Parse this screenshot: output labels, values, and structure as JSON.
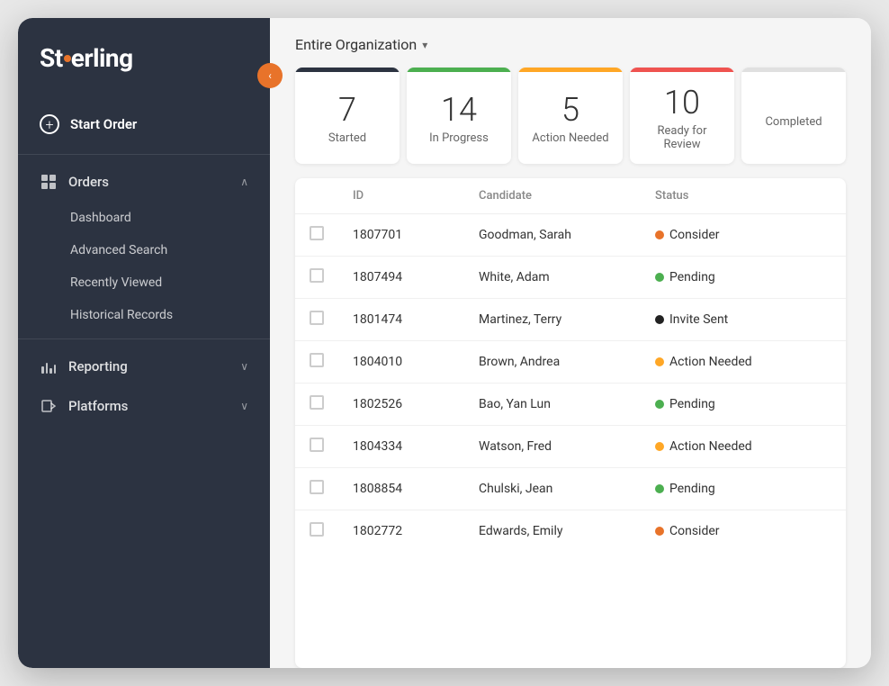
{
  "app": {
    "name": "Sterling",
    "logo_dot": "·"
  },
  "sidebar": {
    "collapse_icon": "‹",
    "start_order": "Start Order",
    "nav_items": [
      {
        "id": "orders",
        "label": "Orders",
        "icon": "grid",
        "has_chevron": true,
        "chevron": "∧",
        "sub_items": [
          "Dashboard",
          "Advanced Search",
          "Recently Viewed",
          "Historical Records"
        ]
      },
      {
        "id": "reporting",
        "label": "Reporting",
        "icon": "bar",
        "has_chevron": true,
        "chevron": "∨"
      },
      {
        "id": "platforms",
        "label": "Platforms",
        "icon": "platform",
        "has_chevron": true,
        "chevron": "∨"
      }
    ]
  },
  "header": {
    "org_selector": "Entire Organization",
    "dropdown_arrow": "▾"
  },
  "stats": [
    {
      "id": "started",
      "number": "7",
      "label": "Started",
      "color": "#2c3341",
      "bar_color": "#2c3341"
    },
    {
      "id": "in-progress",
      "number": "14",
      "label": "In Progress",
      "color": "#4caf50",
      "bar_color": "#4caf50"
    },
    {
      "id": "action-needed",
      "number": "5",
      "label": "Action Needed",
      "color": "#ffa726",
      "bar_color": "#ffa726"
    },
    {
      "id": "ready-for-review",
      "number": "10",
      "label": "Ready for Review",
      "color": "#ef5350",
      "bar_color": "#ef5350"
    },
    {
      "id": "completed",
      "number": "",
      "label": "Completed",
      "color": "#e0e0e0",
      "bar_color": "#e0e0e0"
    }
  ],
  "table": {
    "columns": [
      "",
      "ID",
      "Candidate",
      "Status"
    ],
    "rows": [
      {
        "id": "1807701",
        "candidate": "Goodman, Sarah",
        "status": "Consider",
        "status_color": "#e8732a"
      },
      {
        "id": "1807494",
        "candidate": "White, Adam",
        "status": "Pending",
        "status_color": "#4caf50"
      },
      {
        "id": "1801474",
        "candidate": "Martinez, Terry",
        "status": "Invite Sent",
        "status_color": "#222"
      },
      {
        "id": "1804010",
        "candidate": "Brown, Andrea",
        "status": "Action Needed",
        "status_color": "#ffa726"
      },
      {
        "id": "1802526",
        "candidate": "Bao, Yan Lun",
        "status": "Pending",
        "status_color": "#4caf50"
      },
      {
        "id": "1804334",
        "candidate": "Watson, Fred",
        "status": "Action Needed",
        "status_color": "#ffa726"
      },
      {
        "id": "1808854",
        "candidate": "Chulski, Jean",
        "status": "Pending",
        "status_color": "#4caf50"
      },
      {
        "id": "1802772",
        "candidate": "Edwards, Emily",
        "status": "Consider",
        "status_color": "#e8732a"
      }
    ]
  }
}
